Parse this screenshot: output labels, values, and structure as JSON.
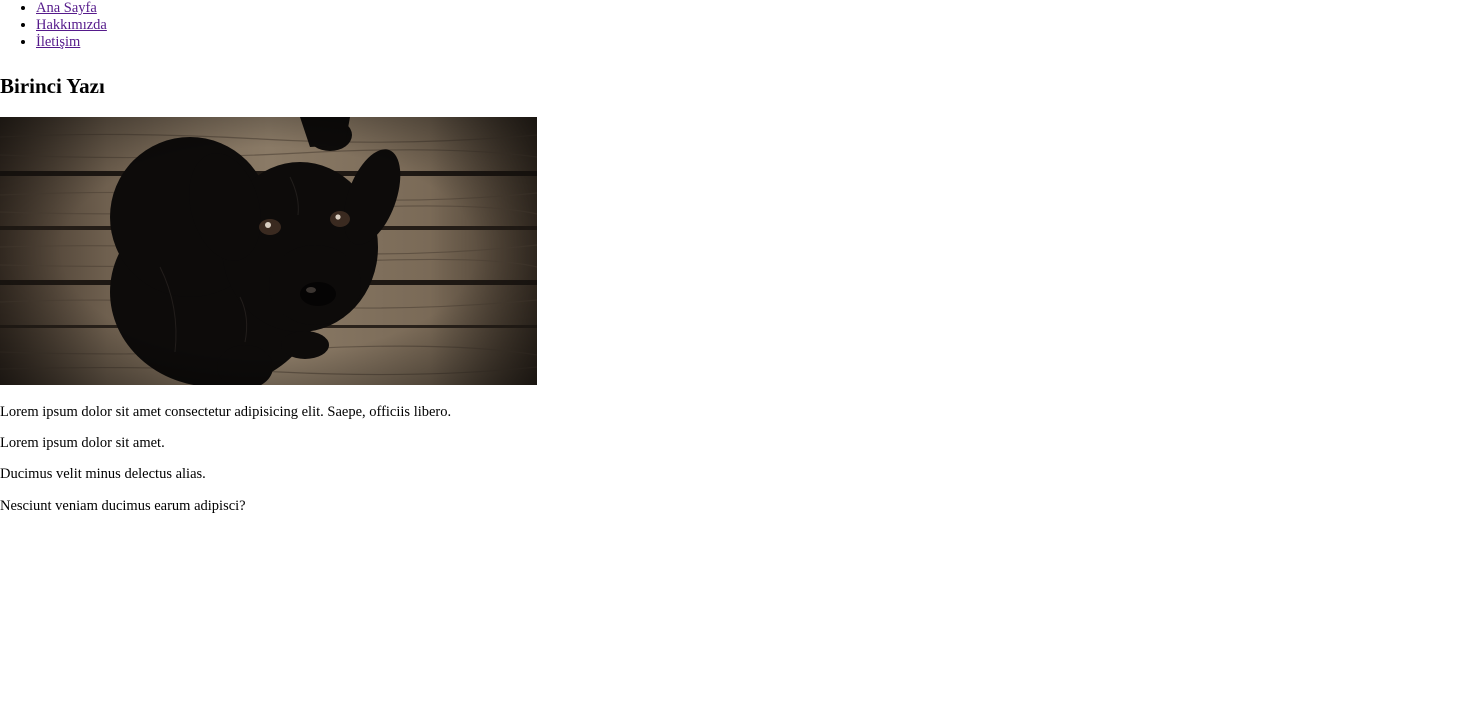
{
  "nav": {
    "items": [
      {
        "label": "Ana Sayfa"
      },
      {
        "label": "Hakkımızda"
      },
      {
        "label": "İletişim"
      }
    ]
  },
  "post": {
    "title": "Birinci Yazı",
    "image": {
      "subject": "black puppy on wooden floor"
    },
    "paragraphs": [
      "Lorem ipsum dolor sit amet consectetur adipisicing elit. Saepe, officiis libero.",
      "Lorem ipsum dolor sit amet.",
      "Ducimus velit minus delectus alias.",
      "Nesciunt veniam ducimus earum adipisci?"
    ]
  },
  "colors": {
    "link_visited": "#551a8b",
    "text": "#000000",
    "background": "#ffffff"
  }
}
